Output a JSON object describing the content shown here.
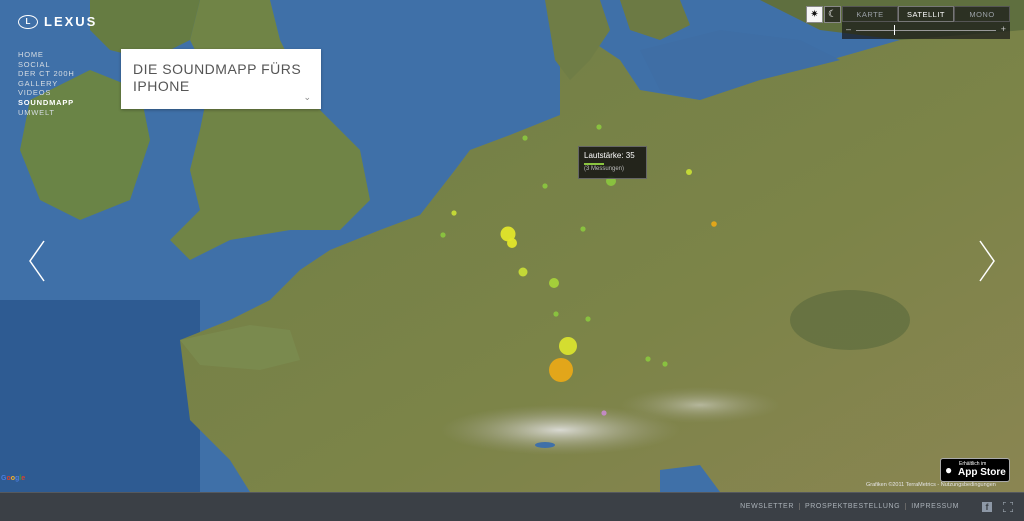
{
  "logo": {
    "mark": "L",
    "name": "LEXUS"
  },
  "nav": {
    "items": [
      {
        "label": "HOME"
      },
      {
        "label": "SOCIAL"
      },
      {
        "label": "DER CT 200h"
      },
      {
        "label": "GALLERY"
      },
      {
        "label": "VIDEOS"
      },
      {
        "label": "SOUNDMAPP",
        "active": true
      },
      {
        "label": "UMWELT"
      }
    ]
  },
  "infobox": {
    "title": "DIE SOUNDMAPP FÜRS IPHONE",
    "chevron_icon": "chevron-down-icon"
  },
  "map_controls": {
    "modes": [
      {
        "icon": "sun-icon",
        "glyph": "✷",
        "active": true
      },
      {
        "icon": "moon-icon",
        "glyph": "☾",
        "active": false
      }
    ],
    "map_types": [
      {
        "label": "KARTE",
        "active": false
      },
      {
        "label": "SATELLIT",
        "active": true
      },
      {
        "label": "MONO",
        "active": false
      }
    ],
    "zoom": {
      "minus": "–",
      "plus": "+"
    }
  },
  "tooltip": {
    "main": "Lautstärke: 35",
    "sub": "(3 Messungen)"
  },
  "appstore": {
    "small": "Erhältlich im",
    "big": "App Store"
  },
  "attribution": "Grafiken ©2011 TerraMetrics - Nutzungsbedingungen",
  "google_logo": [
    "G",
    "o",
    "o",
    "g",
    "l",
    "e"
  ],
  "footer": {
    "links": [
      "NEWSLETTER",
      "PROSPEKTBESTELLUNG",
      "IMPRESSUM"
    ],
    "facebook_glyph": "f"
  },
  "colors": {
    "sea": "#3e6fa6",
    "land": "#6f7f45",
    "marker_green": "#8ac43f",
    "marker_yellow": "#d6e33a",
    "marker_orange": "#e8a818",
    "footer_bg": "#3b4046"
  }
}
